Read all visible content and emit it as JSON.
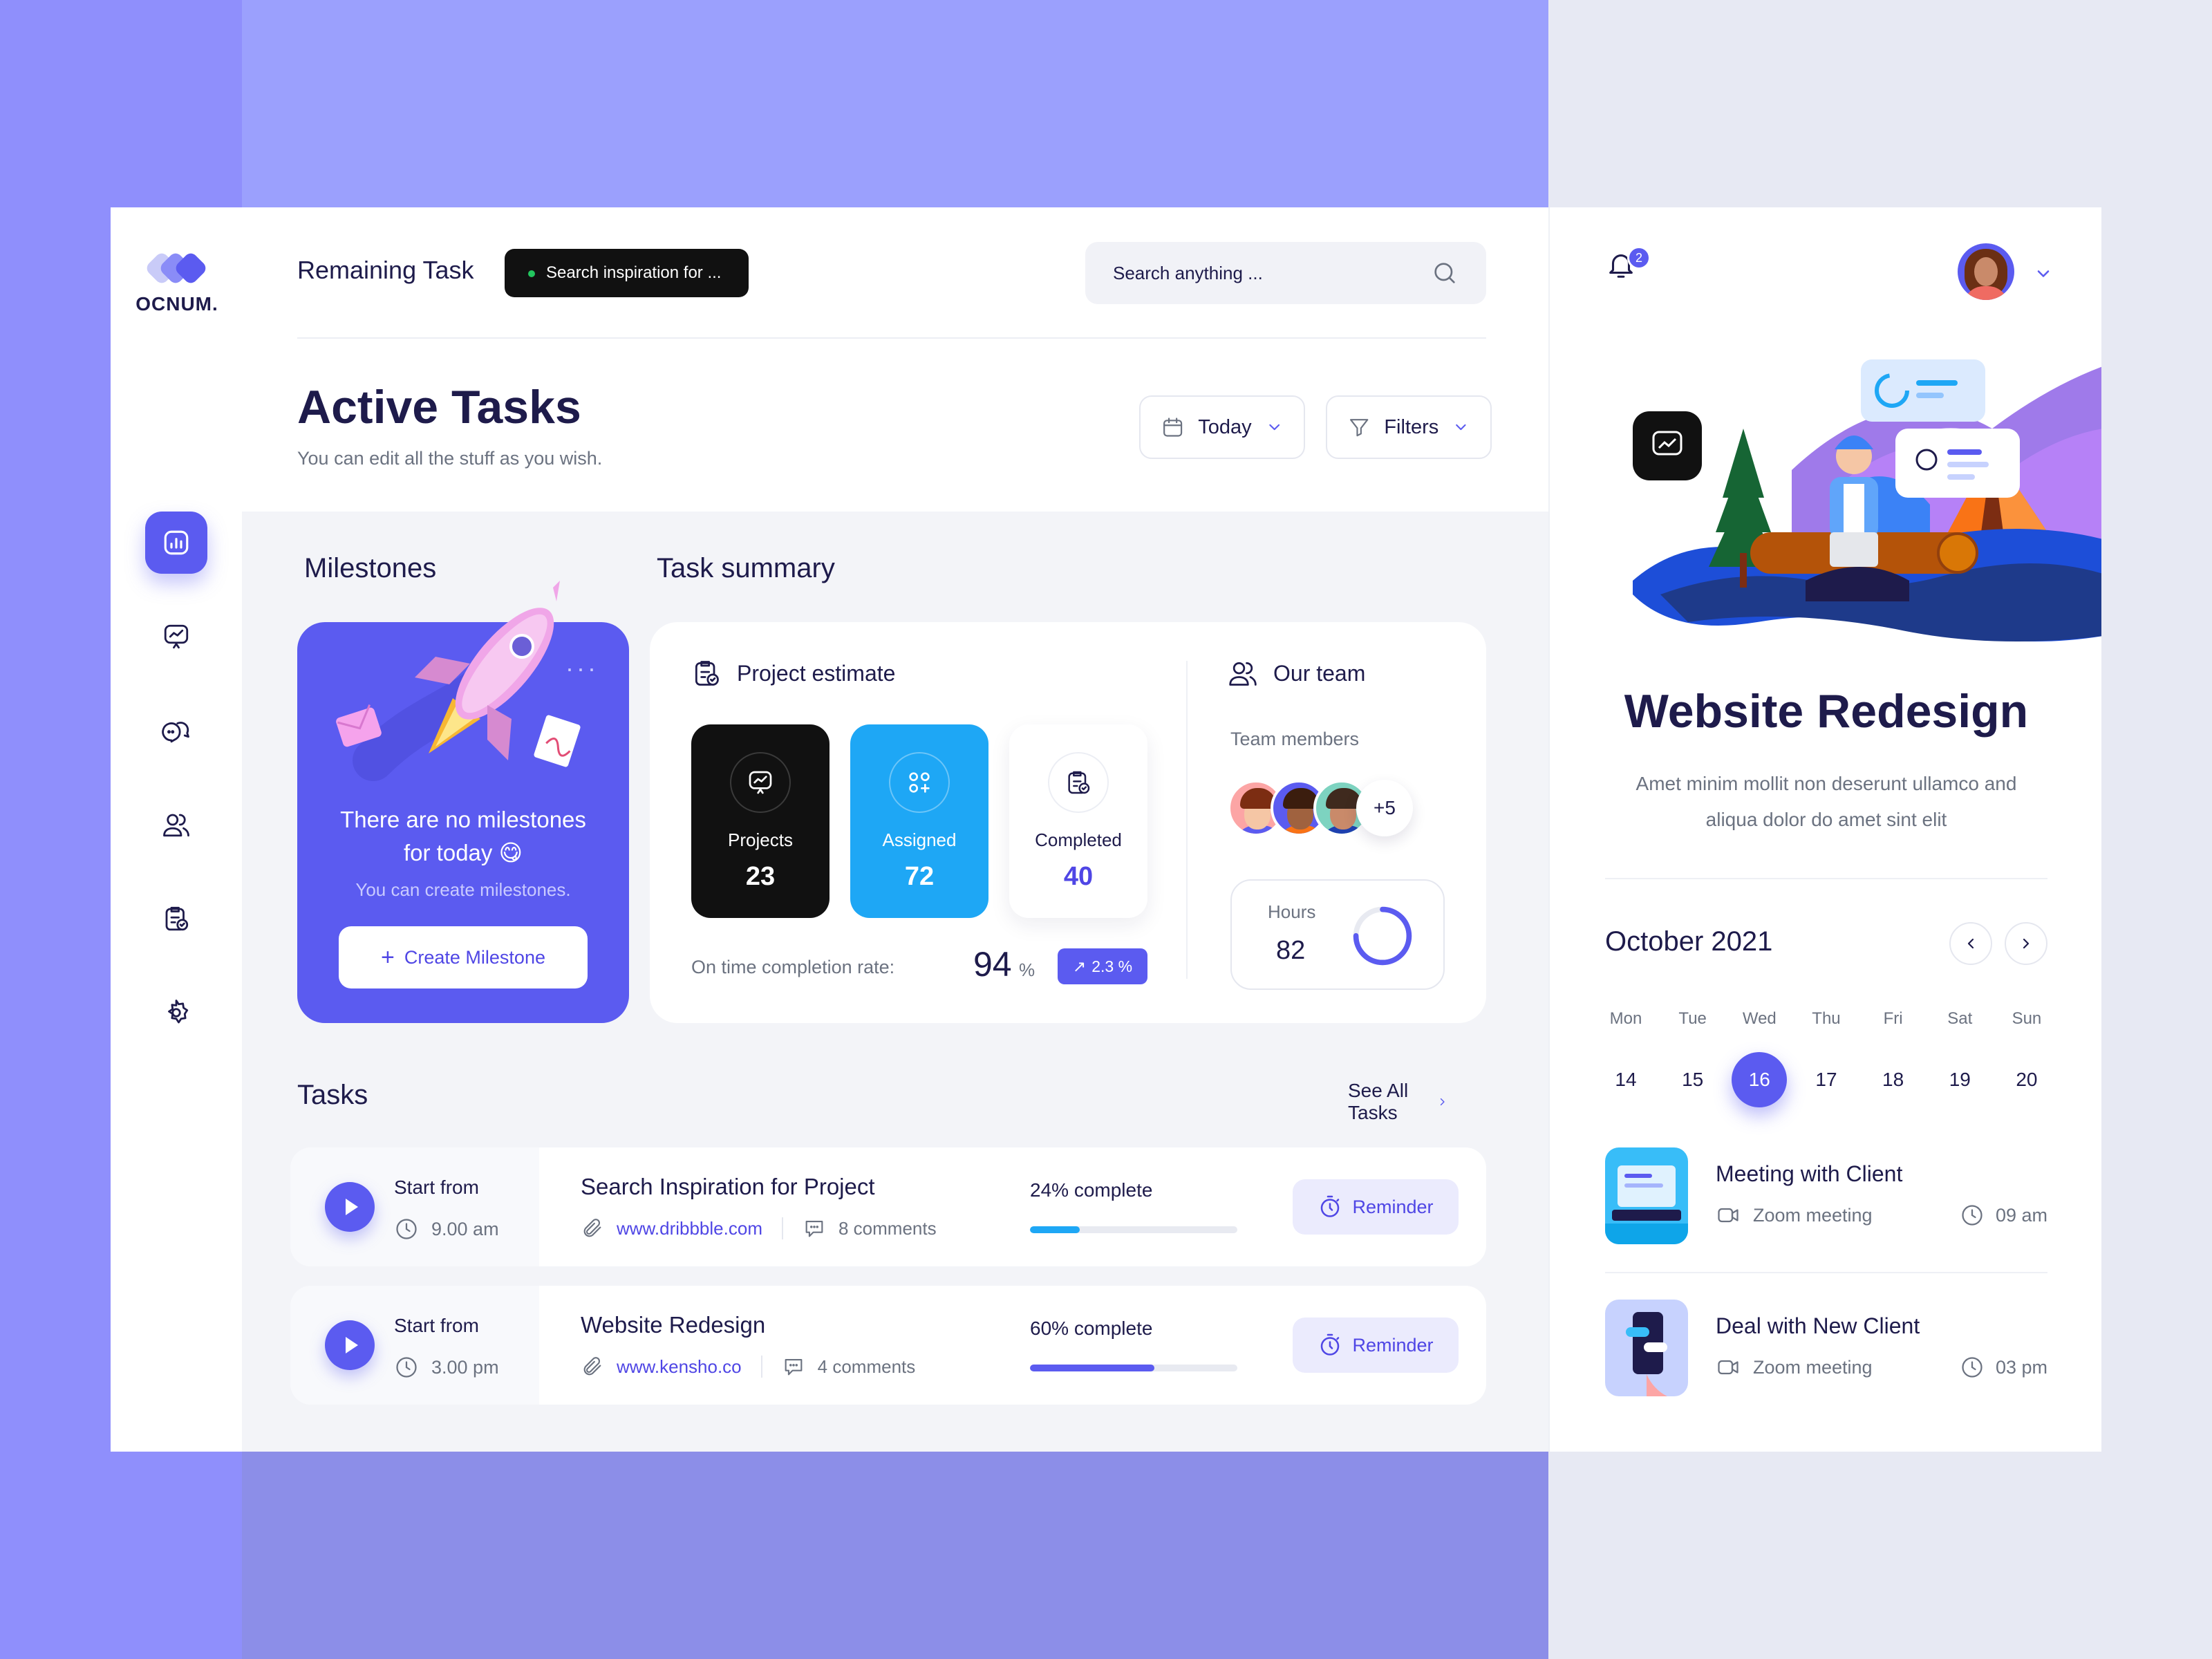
{
  "brand": {
    "name": "OCNUM."
  },
  "header": {
    "remaining_label": "Remaining Task",
    "tooltip_text": "Search inspiration for ...",
    "search_placeholder": "Search anything ..."
  },
  "page": {
    "title": "Active Tasks",
    "subtitle": "You can edit all the stuff as you wish.",
    "date_filter": "Today",
    "filters_label": "Filters"
  },
  "sidebar": {
    "items": [
      {
        "icon": "dashboard-icon",
        "active": true
      },
      {
        "icon": "presentation-icon",
        "active": false
      },
      {
        "icon": "chat-icon",
        "active": false
      },
      {
        "icon": "users-icon",
        "active": false
      },
      {
        "icon": "clipboard-check-icon",
        "active": false
      },
      {
        "icon": "gear-icon",
        "active": false
      }
    ]
  },
  "milestones": {
    "section_title": "Milestones",
    "empty_text_line1": "There are no milestones",
    "empty_text_line2": "for today 😋",
    "sub_text": "You can create milestones.",
    "button_label": "Create Milestone"
  },
  "summary": {
    "section_title": "Task summary",
    "project_estimate_label": "Project estimate",
    "stats": [
      {
        "label": "Projects",
        "value": "23"
      },
      {
        "label": "Assigned",
        "value": "72"
      },
      {
        "label": "Completed",
        "value": "40"
      }
    ],
    "completion_label": "On time completion rate:",
    "completion_value": "94",
    "completion_unit": "%",
    "completion_change": "2.3 %",
    "team_label": "Our team",
    "team_members_label": "Team members",
    "team_more": "+5",
    "hours_label": "Hours",
    "hours_value": "82",
    "hours_progress": 0.75
  },
  "tasks": {
    "section_title": "Tasks",
    "see_all_label": "See All Tasks",
    "items": [
      {
        "start_label": "Start from",
        "start_time": "9.00 am",
        "name": "Search Inspiration for Project",
        "link": "www.dribbble.com",
        "comments": "8 comments",
        "progress_label": "24% complete",
        "progress": 0.24,
        "color": "#1ea7f5",
        "reminder_label": "Reminder"
      },
      {
        "start_label": "Start from",
        "start_time": "3.00 pm",
        "name": "Website Redesign",
        "link": "www.kensho.co",
        "comments": "4 comments",
        "progress_label": "60% complete",
        "progress": 0.6,
        "color": "#5b5bf0",
        "reminder_label": "Reminder"
      }
    ]
  },
  "right_panel": {
    "notification_count": "2",
    "project_title": "Website Redesign",
    "project_desc": "Amet minim mollit non deserunt ullamco and aliqua dolor do amet sint elit",
    "calendar": {
      "month": "October 2021",
      "days": [
        {
          "name": "Mon",
          "date": "14"
        },
        {
          "name": "Tue",
          "date": "15"
        },
        {
          "name": "Wed",
          "date": "16",
          "selected": true
        },
        {
          "name": "Thu",
          "date": "17"
        },
        {
          "name": "Fri",
          "date": "18"
        },
        {
          "name": "Sat",
          "date": "19"
        },
        {
          "name": "Sun",
          "date": "20"
        }
      ]
    },
    "events": [
      {
        "title": "Meeting with Client",
        "type": "Zoom meeting",
        "time": "09 am"
      },
      {
        "title": "Deal with New Client",
        "type": "Zoom meeting",
        "time": "03 pm"
      }
    ]
  },
  "colors": {
    "accent": "#5b5bf0",
    "blue": "#1ea7f5",
    "dark": "#111111",
    "text": "#1e1b4b"
  }
}
